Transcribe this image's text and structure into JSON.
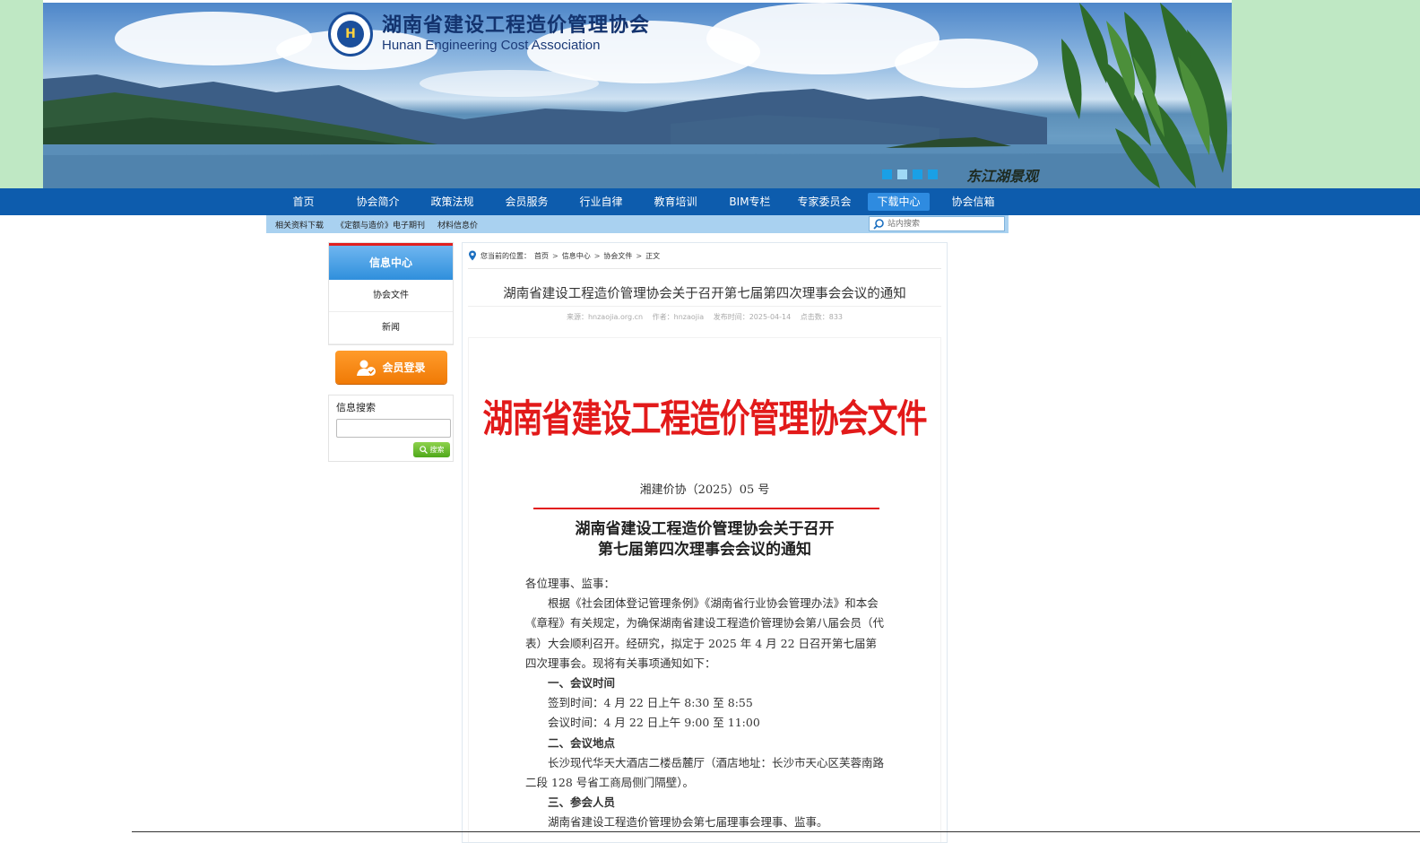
{
  "banner": {
    "org_name_cn": "湖南省建设工程造价管理协会",
    "org_name_en": "Hunan Engineering Cost Association",
    "logo_badge": "H",
    "scenic_caption": "东江湖景观",
    "slide_count": 4
  },
  "nav": {
    "items": [
      "首页",
      "协会简介",
      "政策法规",
      "会员服务",
      "行业自律",
      "教育培训",
      "BIM专栏",
      "专家委员会",
      "下载中心",
      "协会信箱"
    ],
    "active": "下载中心"
  },
  "subnav": {
    "links": [
      "相关资料下载",
      "《定额与造价》电子期刊",
      "材料信息价"
    ],
    "search_placeholder": "站内搜索"
  },
  "sidebar": {
    "header": "信息中心",
    "items": [
      "协会文件",
      "新闻"
    ],
    "member_login": "会员登录",
    "search_label": "信息搜索",
    "search_button": "搜索"
  },
  "breadcrumb": {
    "prefix": "您当前的位置：",
    "items": [
      "首页",
      "信息中心",
      "协会文件",
      "正文"
    ]
  },
  "article": {
    "title": "湖南省建设工程造价管理协会关于召开第七届第四次理事会会议的通知",
    "source": "来源：hnzaojia.org.cn",
    "author": "作者：hnzaojia",
    "published": "发布时间：2025-04-14",
    "views": "点击数：833"
  },
  "document": {
    "header": "湖南省建设工程造价管理协会文件",
    "number": "湘建价协（2025）05 号",
    "title_line1": "湖南省建设工程造价管理协会关于召开",
    "title_line2": "第七届第四次理事会会议的通知",
    "salutation": "各位理事、监事：",
    "intro": "根据《社会团体登记管理条例》《湖南省行业协会管理办法》和本会《章程》有关规定，为确保湖南省建设工程造价管理协会第八届会员（代表）大会顺利召开。经研究，拟定于 2025 年 4 月 22 日召开第七届第四次理事会。现将有关事项通知如下：",
    "section1_title": "一、会议时间",
    "checkin_time": "签到时间：4 月 22 日上午 8:30 至 8:55",
    "meeting_time": "会议时间：4 月 22 日上午 9:00 至 11:00",
    "section2_title": "二、会议地点",
    "venue": "长沙现代华天大酒店二楼岳麓厅（酒店地址：长沙市天心区芙蓉南路二段 128 号省工商局侧门隔壁）。",
    "section3_title": "三、参会人员",
    "attendees": "湖南省建设工程造价管理协会第七届理事会理事、监事。"
  },
  "colors": {
    "nav_blue": "#0d5cad",
    "subnav_blue": "#a9d1f0",
    "doc_red": "#e21a1a",
    "login_orange": "#f07a06",
    "side_green": "#bfe8c4"
  },
  "icons": [
    "location-pin-icon",
    "search-icon",
    "member-user-icon"
  ]
}
